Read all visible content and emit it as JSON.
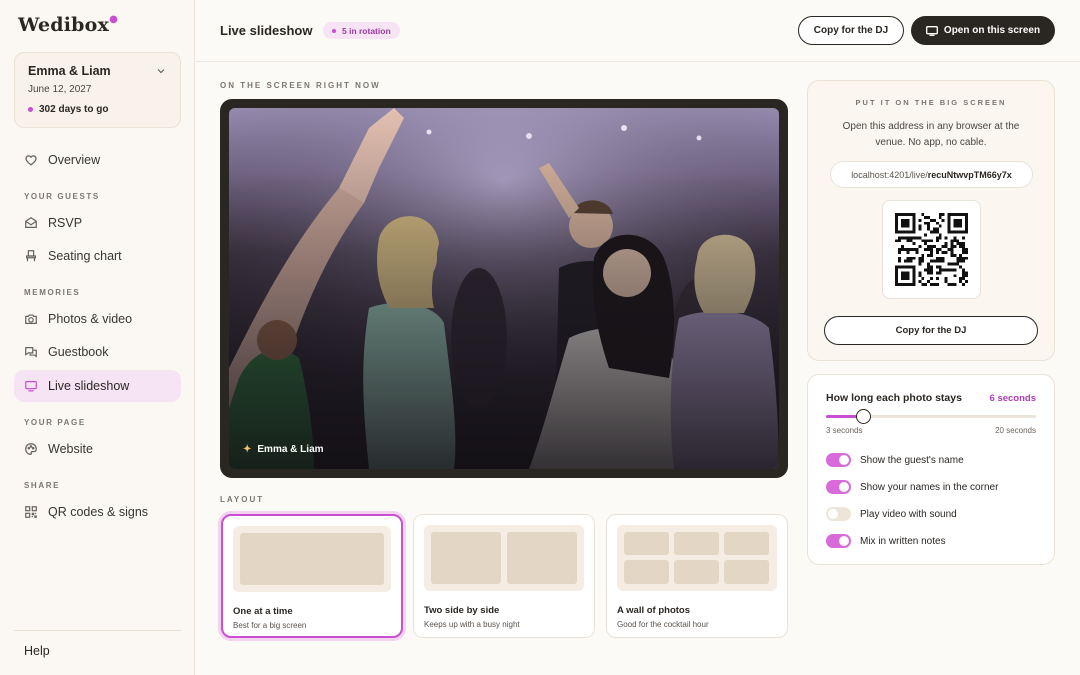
{
  "brand": {
    "name": "Wedibox"
  },
  "event": {
    "names": "Emma & Liam",
    "date": "June 12, 2027",
    "countdown": "302 days to go"
  },
  "sidebar": {
    "overview": "Overview",
    "section_guests": "YOUR GUESTS",
    "rsvp": "RSVP",
    "seating": "Seating chart",
    "section_memories": "MEMORIES",
    "photos": "Photos & video",
    "guestbook": "Guestbook",
    "slideshow": "Live slideshow",
    "section_page": "YOUR PAGE",
    "website": "Website",
    "section_share": "SHARE",
    "qr": "QR codes & signs",
    "help": "Help"
  },
  "header": {
    "title": "Live slideshow",
    "rotation": "5 in rotation",
    "copy_dj": "Copy for the DJ",
    "open_screen": "Open on this screen"
  },
  "main": {
    "screen_label": "ON THE SCREEN RIGHT NOW",
    "caption": "Emma & Liam",
    "layout_label": "LAYOUT",
    "layouts": [
      {
        "title": "One at a time",
        "sub": "Best for a big screen"
      },
      {
        "title": "Two side by side",
        "sub": "Keeps up with a busy night"
      },
      {
        "title": "A wall of photos",
        "sub": "Good for the cocktail hour"
      }
    ],
    "selected_layout": 0
  },
  "cast": {
    "label": "PUT IT ON THE BIG SCREEN",
    "desc": "Open this address in any browser at the venue. No app, no cable.",
    "url_prefix": "localhost:4201/live/",
    "url_id": "recuNtwvpTM66y7x",
    "copy_dj": "Copy for the DJ"
  },
  "settings": {
    "duration_title": "How long each photo stays",
    "duration_value": "6 seconds",
    "duration_seconds": 6,
    "min_label": "3 seconds",
    "max_label": "20 seconds",
    "min": 3,
    "max": 20,
    "toggles": [
      {
        "label": "Show the guest's name",
        "on": true
      },
      {
        "label": "Show your names in the corner",
        "on": true
      },
      {
        "label": "Play video with sound",
        "on": false
      },
      {
        "label": "Mix in written notes",
        "on": true
      }
    ]
  },
  "colors": {
    "accent": "#c84fcf",
    "dark": "#2a2622",
    "background": "#fcfaf6"
  }
}
